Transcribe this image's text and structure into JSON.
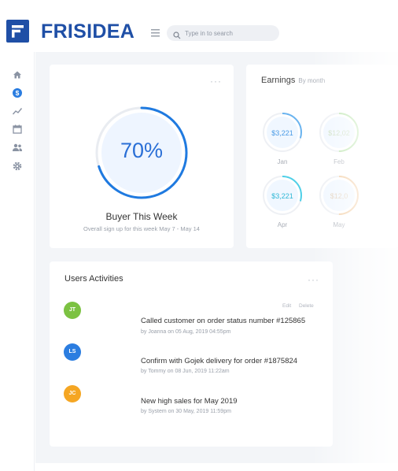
{
  "brand": {
    "name": "FRISIDEA",
    "color": "#1f4fa6"
  },
  "search": {
    "placeholder": "Type in to search"
  },
  "sidebar": {
    "items": [
      {
        "icon": "home-icon"
      },
      {
        "icon": "dollar-icon",
        "active": true
      },
      {
        "icon": "trend-icon"
      },
      {
        "icon": "calendar-icon"
      },
      {
        "icon": "users-icon"
      },
      {
        "icon": "gear-icon"
      }
    ]
  },
  "buyer": {
    "percent_text": "70%",
    "percent": 0.7,
    "title": "Buyer This Week",
    "subtitle": "Overall sign up for this week May 7 - May 14",
    "menu": "···"
  },
  "earnings": {
    "title": "Earnings",
    "subtitle": "By month",
    "items": [
      {
        "value": "$3,221",
        "month": "Jan",
        "color": "#6ab4f0",
        "fraction": 0.3
      },
      {
        "value": "$12,02",
        "month": "Feb",
        "color": "#b7e4a8",
        "fraction": 0.5
      },
      {
        "value": "$3,221",
        "month": "Apr",
        "color": "#4fd0e8",
        "fraction": 0.3
      },
      {
        "value": "$12,0",
        "month": "May",
        "color": "#f2c99a",
        "fraction": 0.5
      }
    ]
  },
  "activities": {
    "title": "Users Activities",
    "menu": "···",
    "edit": "Edit",
    "delete": "Delete",
    "items": [
      {
        "initials": "JT",
        "color": "#7cc242",
        "title": "Called customer on order status number #125865",
        "meta": "by Joanna on 05 Aug, 2019 04:55pm"
      },
      {
        "initials": "LS",
        "color": "#2b7de0",
        "title": "Confirm with Gojek delivery for order #1875824",
        "meta": "by Tommy on 08 Jun, 2019 11:22am"
      },
      {
        "initials": "JC",
        "color": "#f5a623",
        "title": "New high sales for May 2019",
        "meta": "by System on 30 May, 2019 11:59pm"
      }
    ]
  }
}
